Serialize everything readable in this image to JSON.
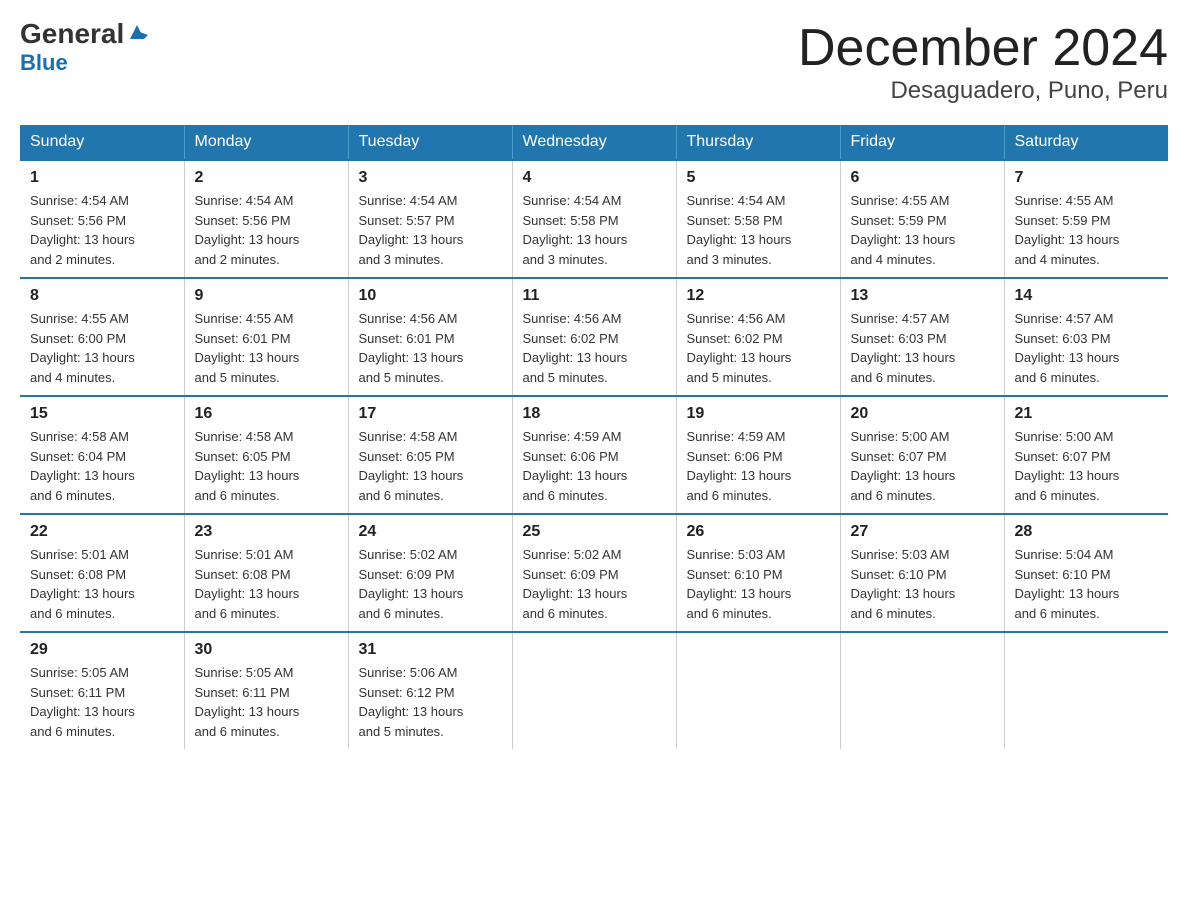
{
  "logo": {
    "name": "General",
    "name2": "Blue"
  },
  "header": {
    "title": "December 2024",
    "subtitle": "Desaguadero, Puno, Peru"
  },
  "days_of_week": [
    "Sunday",
    "Monday",
    "Tuesday",
    "Wednesday",
    "Thursday",
    "Friday",
    "Saturday"
  ],
  "weeks": [
    [
      {
        "day": "1",
        "sunrise": "4:54 AM",
        "sunset": "5:56 PM",
        "daylight": "13 hours and 2 minutes."
      },
      {
        "day": "2",
        "sunrise": "4:54 AM",
        "sunset": "5:56 PM",
        "daylight": "13 hours and 2 minutes."
      },
      {
        "day": "3",
        "sunrise": "4:54 AM",
        "sunset": "5:57 PM",
        "daylight": "13 hours and 3 minutes."
      },
      {
        "day": "4",
        "sunrise": "4:54 AM",
        "sunset": "5:58 PM",
        "daylight": "13 hours and 3 minutes."
      },
      {
        "day": "5",
        "sunrise": "4:54 AM",
        "sunset": "5:58 PM",
        "daylight": "13 hours and 3 minutes."
      },
      {
        "day": "6",
        "sunrise": "4:55 AM",
        "sunset": "5:59 PM",
        "daylight": "13 hours and 4 minutes."
      },
      {
        "day": "7",
        "sunrise": "4:55 AM",
        "sunset": "5:59 PM",
        "daylight": "13 hours and 4 minutes."
      }
    ],
    [
      {
        "day": "8",
        "sunrise": "4:55 AM",
        "sunset": "6:00 PM",
        "daylight": "13 hours and 4 minutes."
      },
      {
        "day": "9",
        "sunrise": "4:55 AM",
        "sunset": "6:01 PM",
        "daylight": "13 hours and 5 minutes."
      },
      {
        "day": "10",
        "sunrise": "4:56 AM",
        "sunset": "6:01 PM",
        "daylight": "13 hours and 5 minutes."
      },
      {
        "day": "11",
        "sunrise": "4:56 AM",
        "sunset": "6:02 PM",
        "daylight": "13 hours and 5 minutes."
      },
      {
        "day": "12",
        "sunrise": "4:56 AM",
        "sunset": "6:02 PM",
        "daylight": "13 hours and 5 minutes."
      },
      {
        "day": "13",
        "sunrise": "4:57 AM",
        "sunset": "6:03 PM",
        "daylight": "13 hours and 6 minutes."
      },
      {
        "day": "14",
        "sunrise": "4:57 AM",
        "sunset": "6:03 PM",
        "daylight": "13 hours and 6 minutes."
      }
    ],
    [
      {
        "day": "15",
        "sunrise": "4:58 AM",
        "sunset": "6:04 PM",
        "daylight": "13 hours and 6 minutes."
      },
      {
        "day": "16",
        "sunrise": "4:58 AM",
        "sunset": "6:05 PM",
        "daylight": "13 hours and 6 minutes."
      },
      {
        "day": "17",
        "sunrise": "4:58 AM",
        "sunset": "6:05 PM",
        "daylight": "13 hours and 6 minutes."
      },
      {
        "day": "18",
        "sunrise": "4:59 AM",
        "sunset": "6:06 PM",
        "daylight": "13 hours and 6 minutes."
      },
      {
        "day": "19",
        "sunrise": "4:59 AM",
        "sunset": "6:06 PM",
        "daylight": "13 hours and 6 minutes."
      },
      {
        "day": "20",
        "sunrise": "5:00 AM",
        "sunset": "6:07 PM",
        "daylight": "13 hours and 6 minutes."
      },
      {
        "day": "21",
        "sunrise": "5:00 AM",
        "sunset": "6:07 PM",
        "daylight": "13 hours and 6 minutes."
      }
    ],
    [
      {
        "day": "22",
        "sunrise": "5:01 AM",
        "sunset": "6:08 PM",
        "daylight": "13 hours and 6 minutes."
      },
      {
        "day": "23",
        "sunrise": "5:01 AM",
        "sunset": "6:08 PM",
        "daylight": "13 hours and 6 minutes."
      },
      {
        "day": "24",
        "sunrise": "5:02 AM",
        "sunset": "6:09 PM",
        "daylight": "13 hours and 6 minutes."
      },
      {
        "day": "25",
        "sunrise": "5:02 AM",
        "sunset": "6:09 PM",
        "daylight": "13 hours and 6 minutes."
      },
      {
        "day": "26",
        "sunrise": "5:03 AM",
        "sunset": "6:10 PM",
        "daylight": "13 hours and 6 minutes."
      },
      {
        "day": "27",
        "sunrise": "5:03 AM",
        "sunset": "6:10 PM",
        "daylight": "13 hours and 6 minutes."
      },
      {
        "day": "28",
        "sunrise": "5:04 AM",
        "sunset": "6:10 PM",
        "daylight": "13 hours and 6 minutes."
      }
    ],
    [
      {
        "day": "29",
        "sunrise": "5:05 AM",
        "sunset": "6:11 PM",
        "daylight": "13 hours and 6 minutes."
      },
      {
        "day": "30",
        "sunrise": "5:05 AM",
        "sunset": "6:11 PM",
        "daylight": "13 hours and 6 minutes."
      },
      {
        "day": "31",
        "sunrise": "5:06 AM",
        "sunset": "6:12 PM",
        "daylight": "13 hours and 5 minutes."
      },
      null,
      null,
      null,
      null
    ]
  ],
  "labels": {
    "sunrise": "Sunrise:",
    "sunset": "Sunset:",
    "daylight": "Daylight:"
  }
}
